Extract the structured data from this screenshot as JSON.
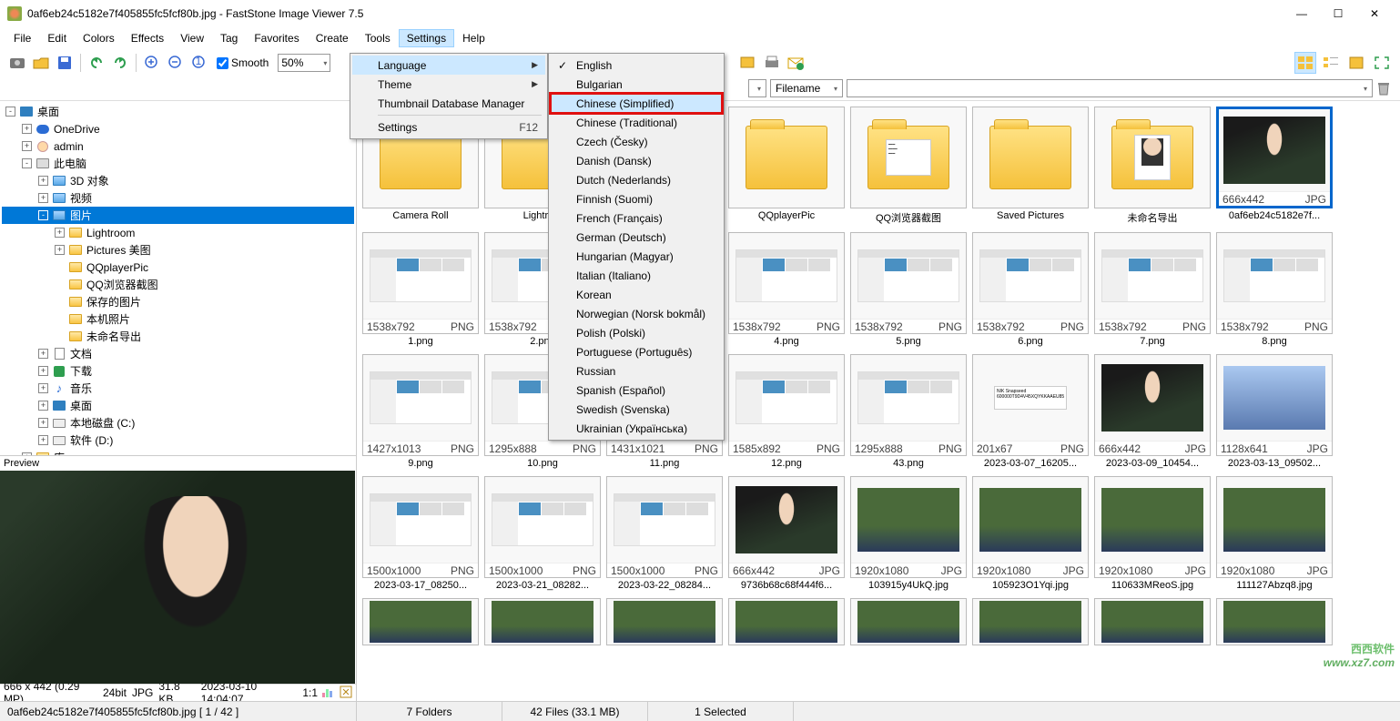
{
  "title": "0af6eb24c5182e7f405855fc5fcf80b.jpg   -   FastStone Image Viewer 7.5",
  "menubar": [
    "File",
    "Edit",
    "Colors",
    "Effects",
    "View",
    "Tag",
    "Favorites",
    "Create",
    "Tools",
    "Settings",
    "Help"
  ],
  "toolbar_smooth": "Smooth",
  "toolbar_zoom": "50%",
  "filter_sort": "Filename",
  "settings_menu": {
    "language": "Language",
    "theme": "Theme",
    "tdm": "Thumbnail Database Manager",
    "settings": "Settings",
    "settings_shortcut": "F12"
  },
  "languages": [
    "English",
    "Bulgarian",
    "Chinese (Simplified)",
    "Chinese (Traditional)",
    "Czech (Česky)",
    "Danish (Dansk)",
    "Dutch (Nederlands)",
    "Finnish (Suomi)",
    "French (Français)",
    "German (Deutsch)",
    "Hungarian (Magyar)",
    "Italian (Italiano)",
    "Korean",
    "Norwegian (Norsk bokmål)",
    "Polish (Polski)",
    "Portuguese (Português)",
    "Russian",
    "Spanish (Español)",
    "Swedish (Svenska)",
    "Ukrainian (Українська)"
  ],
  "languages_checked_index": 0,
  "languages_highlight_index": 2,
  "tree": [
    {
      "depth": 0,
      "exp": "-",
      "icon": "desk",
      "label": "桌面"
    },
    {
      "depth": 1,
      "exp": "+",
      "icon": "cloud",
      "label": "OneDrive"
    },
    {
      "depth": 1,
      "exp": "+",
      "icon": "user",
      "label": "admin"
    },
    {
      "depth": 1,
      "exp": "-",
      "icon": "pc",
      "label": "此电脑"
    },
    {
      "depth": 2,
      "exp": "+",
      "icon": "folder-blue",
      "label": "3D 对象"
    },
    {
      "depth": 2,
      "exp": "+",
      "icon": "folder-blue",
      "label": "视频"
    },
    {
      "depth": 2,
      "exp": "-",
      "icon": "folder-blue",
      "label": "图片",
      "selected": true
    },
    {
      "depth": 3,
      "exp": "+",
      "icon": "folder",
      "label": "Lightroom"
    },
    {
      "depth": 3,
      "exp": "+",
      "icon": "folder",
      "label": "Pictures 美图"
    },
    {
      "depth": 3,
      "exp": "",
      "icon": "folder",
      "label": "QQplayerPic"
    },
    {
      "depth": 3,
      "exp": "",
      "icon": "folder",
      "label": "QQ浏览器截图"
    },
    {
      "depth": 3,
      "exp": "",
      "icon": "folder",
      "label": "保存的图片"
    },
    {
      "depth": 3,
      "exp": "",
      "icon": "folder",
      "label": "本机照片"
    },
    {
      "depth": 3,
      "exp": "",
      "icon": "folder",
      "label": "未命名导出"
    },
    {
      "depth": 2,
      "exp": "+",
      "icon": "doc",
      "label": "文档"
    },
    {
      "depth": 2,
      "exp": "+",
      "icon": "down",
      "label": "下载"
    },
    {
      "depth": 2,
      "exp": "+",
      "icon": "music",
      "label": "音乐"
    },
    {
      "depth": 2,
      "exp": "+",
      "icon": "desk",
      "label": "桌面"
    },
    {
      "depth": 2,
      "exp": "+",
      "icon": "disk",
      "label": "本地磁盘 (C:)"
    },
    {
      "depth": 2,
      "exp": "+",
      "icon": "disk",
      "label": "软件 (D:)"
    },
    {
      "depth": 1,
      "exp": "+",
      "icon": "folder",
      "label": "库"
    }
  ],
  "preview_label": "Preview",
  "preview_status": {
    "dims": "666 x 442 (0.29 MP)",
    "depth": "24bit",
    "ext": "JPG",
    "size": "31.8 KB",
    "date": "2023-03-10 14:04:07",
    "ratio": "1:1"
  },
  "folders": [
    {
      "name": "Camera Roll"
    },
    {
      "name": "Lightro..."
    },
    {
      "name": ""
    },
    {
      "name": "QQplayerPic"
    },
    {
      "name": "QQ浏览器截图",
      "doc": true
    },
    {
      "name": "Saved Pictures"
    },
    {
      "name": "未命名导出",
      "photo": true
    }
  ],
  "selected_file": {
    "name": "0af6eb24c5182e7f...",
    "dims": "666x442",
    "ext": "JPG"
  },
  "files": [
    {
      "name": "1.png",
      "dims": "1538x792",
      "ext": "PNG",
      "type": "app"
    },
    {
      "name": "2.png",
      "dims": "1538x792",
      "ext": "PNG",
      "type": "app"
    },
    {
      "name": "",
      "dims": "",
      "ext": "",
      "type": "hidden"
    },
    {
      "name": "4.png",
      "dims": "1538x792",
      "ext": "PNG",
      "type": "app"
    },
    {
      "name": "5.png",
      "dims": "1538x792",
      "ext": "PNG",
      "type": "app"
    },
    {
      "name": "6.png",
      "dims": "1538x792",
      "ext": "PNG",
      "type": "app"
    },
    {
      "name": "7.png",
      "dims": "1538x792",
      "ext": "PNG",
      "type": "app"
    },
    {
      "name": "8.png",
      "dims": "1538x792",
      "ext": "PNG",
      "type": "app"
    },
    {
      "name": "9.png",
      "dims": "1427x1013",
      "ext": "PNG",
      "type": "app"
    },
    {
      "name": "10.png",
      "dims": "1295x888",
      "ext": "PNG",
      "type": "app"
    },
    {
      "name": "11.png",
      "dims": "1431x1021",
      "ext": "PNG",
      "type": "app"
    },
    {
      "name": "12.png",
      "dims": "1585x892",
      "ext": "PNG",
      "type": "app"
    },
    {
      "name": "43.png",
      "dims": "1295x888",
      "ext": "PNG",
      "type": "app"
    },
    {
      "name": "2023-03-07_16205...",
      "dims": "201x67",
      "ext": "PNG",
      "type": "small"
    },
    {
      "name": "2023-03-09_10454...",
      "dims": "666x442",
      "ext": "JPG",
      "type": "photo"
    },
    {
      "name": "2023-03-13_09502...",
      "dims": "1128x641",
      "ext": "JPG",
      "type": "anime"
    },
    {
      "name": "2023-03-17_08250...",
      "dims": "1500x1000",
      "ext": "PNG",
      "type": "app"
    },
    {
      "name": "2023-03-21_08282...",
      "dims": "1500x1000",
      "ext": "PNG",
      "type": "app"
    },
    {
      "name": "2023-03-22_08284...",
      "dims": "1500x1000",
      "ext": "PNG",
      "type": "app"
    },
    {
      "name": "9736b68c68f444f6...",
      "dims": "666x442",
      "ext": "JPG",
      "type": "photo"
    },
    {
      "name": "103915y4UkQ.jpg",
      "dims": "1920x1080",
      "ext": "JPG",
      "type": "scenery"
    },
    {
      "name": "105923O1Yqi.jpg",
      "dims": "1920x1080",
      "ext": "JPG",
      "type": "scenery"
    },
    {
      "name": "110633MReoS.jpg",
      "dims": "1920x1080",
      "ext": "JPG",
      "type": "scenery"
    },
    {
      "name": "111127Abzq8.jpg",
      "dims": "1920x1080",
      "ext": "JPG",
      "type": "scenery"
    }
  ],
  "partial_row": 8,
  "statusbar": {
    "file": "0af6eb24c5182e7f405855fc5fcf80b.jpg  [ 1 / 42 ]",
    "folders": "7 Folders",
    "files": "42 Files (33.1 MB)",
    "selected": "1 Selected"
  },
  "watermark": {
    "brand": "西西软件",
    "url": "www.xz7.com"
  }
}
